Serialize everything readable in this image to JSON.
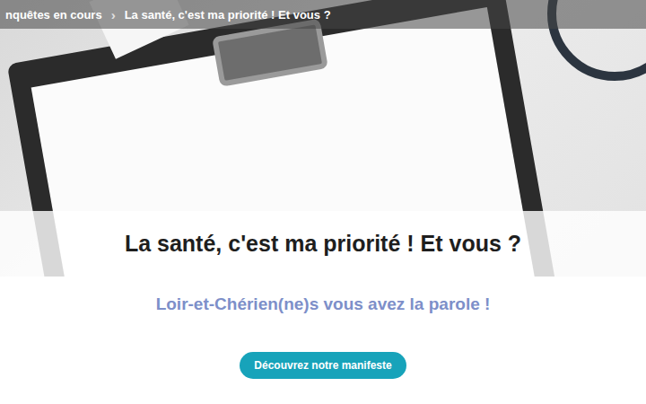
{
  "breadcrumb": {
    "items": [
      "nquêtes en cours",
      "La santé, c'est ma priorité ! Et vous ?"
    ],
    "separator": "›"
  },
  "hero": {
    "title": "La santé, c'est ma priorité ! Et vous ?"
  },
  "subtitle": "Loir-et-Chérien(ne)s vous avez la parole !",
  "button": "Découvrez notre manifeste"
}
